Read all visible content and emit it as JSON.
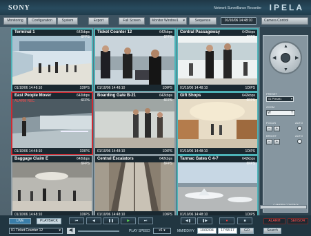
{
  "header": {
    "brand": "SONY",
    "product_name": "Network Surveillance Recorder",
    "product_brand": "IPELA"
  },
  "toolbar": {
    "monitoring": "Monitoring",
    "configuration": "Configuration",
    "system": "System",
    "export": "Export",
    "full_screen": "Full Screen",
    "monitor_window": "Monitor Window1",
    "sequence": "Sequence",
    "datetime": "01/10/06 14:48:10",
    "camera_control_tab": "Camera Control"
  },
  "cameras": [
    {
      "name": "Terminal 1",
      "kbps": "642kbps",
      "fps": "6FPS",
      "timestamp": "01/10/06 14:48:10",
      "dips": "1DIPS",
      "alarm": ""
    },
    {
      "name": "Ticket Counter 12",
      "kbps": "642kbps",
      "fps": "6FPS",
      "timestamp": "01/10/06 14:48:10",
      "dips": "1DIPS",
      "alarm": ""
    },
    {
      "name": "Central Passageway",
      "kbps": "642kbps",
      "fps": "6FPS",
      "timestamp": "01/10/06 14:48:10",
      "dips": "1DIPS",
      "alarm": ""
    },
    {
      "name": "East People Mover",
      "kbps": "642kbps",
      "fps": "6FPS",
      "timestamp": "01/10/06 14:48:10",
      "dips": "1DIPS",
      "alarm": "ALARM REC"
    },
    {
      "name": "Boarding Gate B-21",
      "kbps": "642kbps",
      "fps": "6FPS",
      "timestamp": "01/10/06 14:48:10",
      "dips": "1DIPS",
      "alarm": ""
    },
    {
      "name": "Gift Shops",
      "kbps": "642kbps",
      "fps": "6FPS",
      "timestamp": "01/10/06 14:48:10",
      "dips": "1DIPS",
      "alarm": ""
    },
    {
      "name": "Baggage Claim E",
      "kbps": "642kbps",
      "fps": "6FPS",
      "timestamp": "01/10/06 14:48:10",
      "dips": "1DIPS",
      "alarm": ""
    },
    {
      "name": "Central Escalators",
      "kbps": "642kbps",
      "fps": "6FPS",
      "timestamp": "01/10/06 14:48:10",
      "dips": "1DIPS",
      "alarm": ""
    },
    {
      "name": "Tarmac Gates C 4-7",
      "kbps": "642kbps",
      "fps": "6FPS",
      "timestamp": "01/10/06 14:48:10",
      "dips": "1DIPS",
      "alarm": ""
    }
  ],
  "camera_control": {
    "preset_label": "PRESET",
    "preset_value": "01 Preset1",
    "zoom_label": "ZOOM",
    "zoom_w": "W",
    "zoom_t": "T",
    "focus_label": "FOCUS",
    "focus_auto": "AUTO",
    "bright_label": "BRIGHT",
    "bright_auto": "AUTO",
    "panel_title": "CAMERA CONTROL"
  },
  "bottom": {
    "live": "LIVE",
    "playback": "PLAYBACK",
    "camera_select": "01 Ticket Counter 12",
    "play_speed_label": "PLAY SPEED",
    "play_speed_value": "x1",
    "date_label": "MM/DD/YY",
    "date_value": "10/02/04",
    "time_value": "17:58:17",
    "go": "GO",
    "search": "Search",
    "alarm": "ALARM",
    "sensor": "SENSOR"
  },
  "colors": {
    "accent": "#4db3b8",
    "alarm": "#cf2a32",
    "panel": "#8696a0"
  },
  "icons": [
    "rewind-icon",
    "step-back-icon",
    "pause-icon",
    "play-icon",
    "fast-forward-icon",
    "record-icon",
    "stop-icon",
    "speaker-icon",
    "ptz-arrow-icon"
  ]
}
